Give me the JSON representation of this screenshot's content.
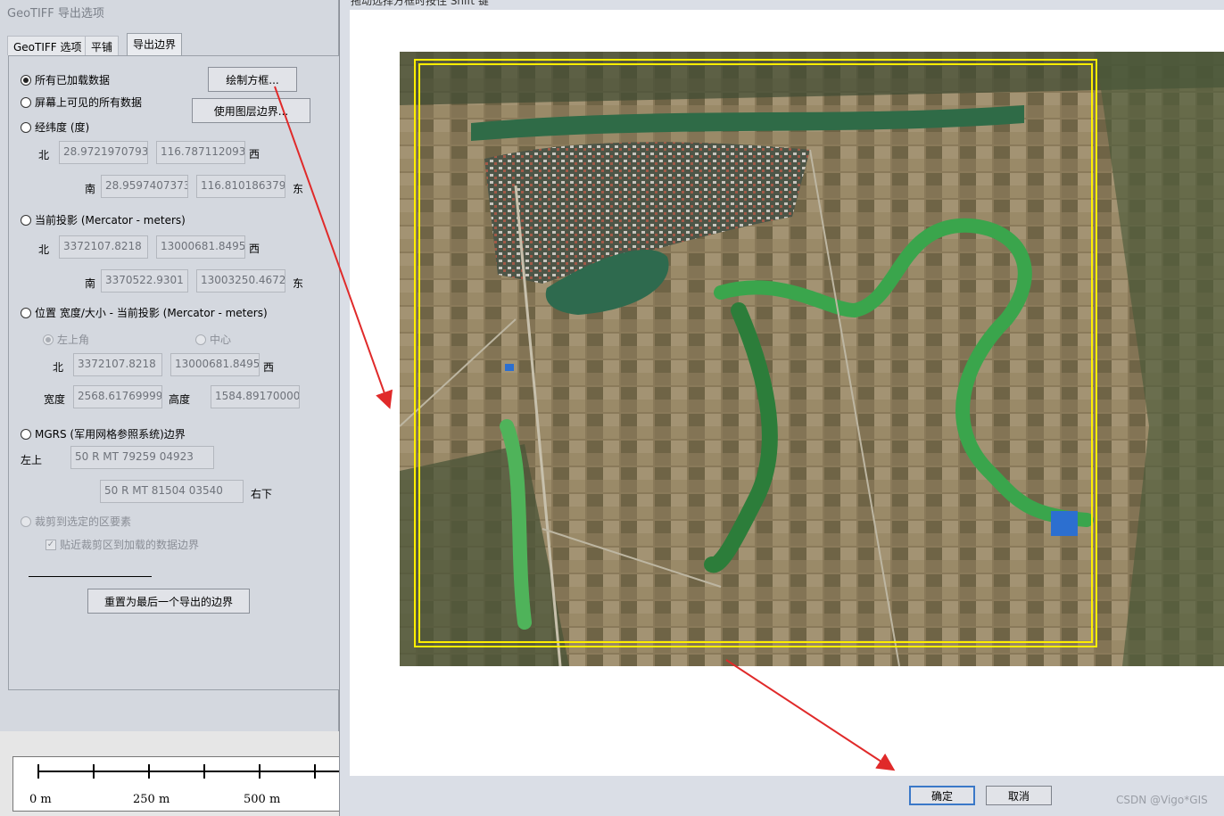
{
  "left_dialog": {
    "title": "GeoTIFF 导出选项",
    "tabs": [
      {
        "label": "GeoTIFF 选项"
      },
      {
        "label": "平铺"
      },
      {
        "label": "导出边界"
      }
    ],
    "options": {
      "all_loaded": "所有已加载数据",
      "screen_visible": "屏幕上可见的所有数据",
      "latlon": "经纬度 (度)",
      "current_proj": "当前投影 (Mercator - meters)",
      "position_size": "位置 宽度/大小 - 当前投影 (Mercator - meters)",
      "mgrs": "MGRS (军用网格参照系统)边界",
      "crop_to_feature": "裁剪到选定的区要素"
    },
    "buttons": {
      "draw_box": "绘制方框...",
      "use_layer_bounds": "使用图层边界...",
      "reset_bounds": "重置为最后一个导出的边界"
    },
    "latlon": {
      "north_label": "北",
      "north": "28.97219707931",
      "west": "116.7871120938",
      "west_label": "西",
      "south_label": "南",
      "south": "28.95974073736",
      "east": "116.8101863792",
      "east_label": "东"
    },
    "proj": {
      "north_label": "北",
      "north": "3372107.8218",
      "west": "13000681.8495",
      "west_label": "西",
      "south_label": "南",
      "south": "3370522.9301",
      "east": "13003250.4672",
      "east_label": "东"
    },
    "position": {
      "top_left": "左上角",
      "center": "中心",
      "north_label": "北",
      "north": "3372107.8218",
      "west": "13000681.8495",
      "west_label": "西",
      "width_label": "宽度",
      "width": "2568.617699999",
      "height_label": "高度",
      "height": "1584.891700000"
    },
    "mgrs": {
      "top_left_label": "左上",
      "top_left": "50 R MT 79259 04923",
      "bottom_right": "50 R MT 81504 03540",
      "bottom_right_label": "右下"
    },
    "snap_crop": "贴近裁剪区到加载的数据边界"
  },
  "scale_bar": {
    "ticks": [
      "0 m",
      "250 m",
      "500 m"
    ]
  },
  "right_dialog": {
    "title": "拖动选择方框时按住 Shift 键",
    "ok": "确定",
    "cancel": "取消"
  },
  "watermark": "CSDN @Vigo*GIS",
  "colors": {
    "arrow": "#e02a2a",
    "selection_box": "#ffee00",
    "ok_border": "#3a78c8"
  }
}
